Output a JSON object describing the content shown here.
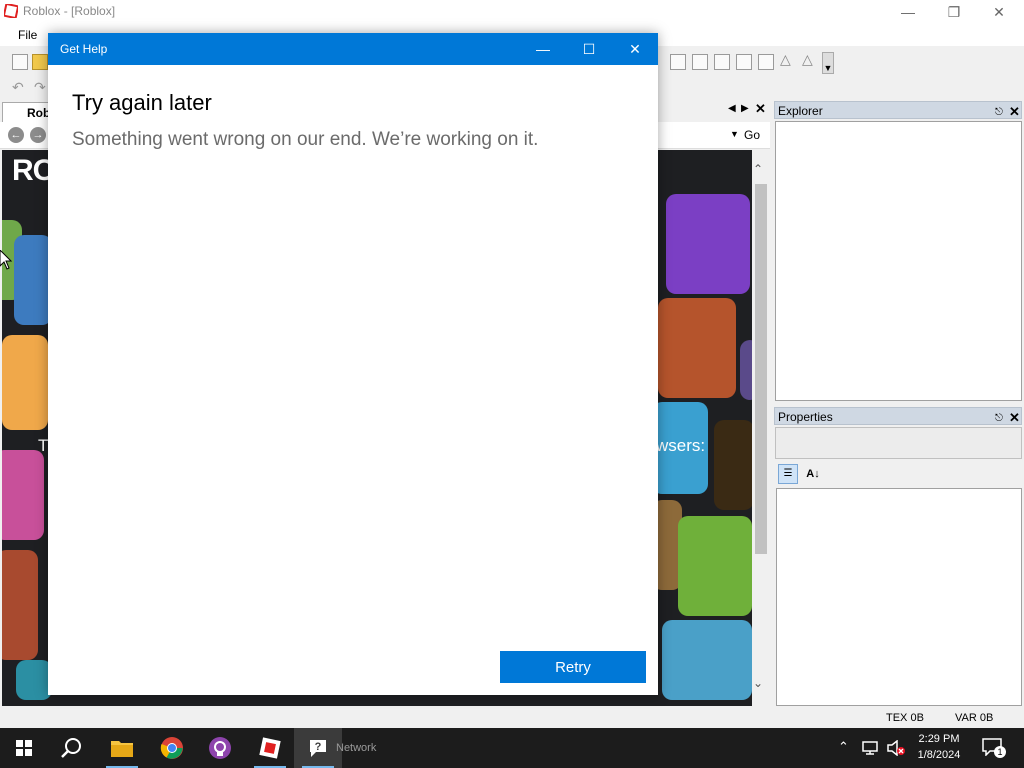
{
  "studio": {
    "title": "Roblox - [Roblox]",
    "menu": [
      "File"
    ],
    "doc_tab_label": "Robl",
    "go_label": "Go",
    "start_page": {
      "logo_text": "RO",
      "left_fragment": "T",
      "right_fragment": "wsers:"
    },
    "explorer": {
      "title": "Explorer"
    },
    "properties": {
      "title": "Properties"
    },
    "status": {
      "tex": "TEX 0B",
      "var": "VAR 0B"
    }
  },
  "dialog": {
    "title": "Get Help",
    "heading": "Try again later",
    "message": "Something went wrong on our end. We’re working on it.",
    "retry_label": "Retry"
  },
  "taskbar": {
    "network_label": "Network",
    "time": "2:29 PM",
    "date": "1/8/2024",
    "notification_count": "1"
  },
  "colors": {
    "accent": "#0078d7",
    "taskbar": "#1c1c1c",
    "startpage_bg": "#1e1f22"
  }
}
